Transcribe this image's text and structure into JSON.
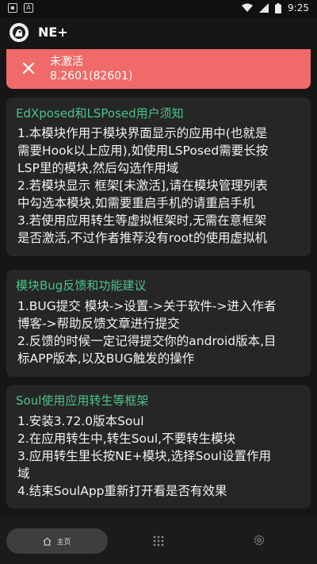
{
  "status_bar": {
    "time": "9:25"
  },
  "app_bar": {
    "title": "NE+"
  },
  "banner": {
    "status": "未激活",
    "version": "8.2601(82601)"
  },
  "cards": [
    {
      "title": "EdXposed和LSPosed用户须知",
      "lines": [
        "1.本模块作用于模块界面显示的应用中(也就是",
        "需要Hook以上应用),如使用LSPosed需要长按",
        "LSP里的模块,然后勾选作用域",
        "2.若模块显示 框架[未激活],请在模块管理列表",
        "中勾选本模块,如需要重启手机的请重启手机",
        "3.若使用应用转生等虚拟框架时,无需在意框架",
        "是否激活,不过作者推荐没有root的使用虚拟机"
      ]
    },
    {
      "title": "模块Bug反馈和功能建议",
      "lines": [
        "1.BUG提交 模块->设置->关于软件->进入作者",
        "博客->帮助反馈文章进行提交",
        "2.反馈的时候一定记得提交你的android版本,目",
        "标APP版本,以及BUG触发的操作"
      ]
    },
    {
      "title": "Soul使用应用转生等框架",
      "lines": [
        "1.安装3.72.0版本Soul",
        "2.在应用转生中,转生Soul,不要转生模块",
        "3.应用转生里长按NE+模块,选择Soul设置作用",
        "域",
        "4.结束SoulApp重新打开看是否有效果"
      ]
    }
  ],
  "nav": {
    "home_label": "主页"
  }
}
